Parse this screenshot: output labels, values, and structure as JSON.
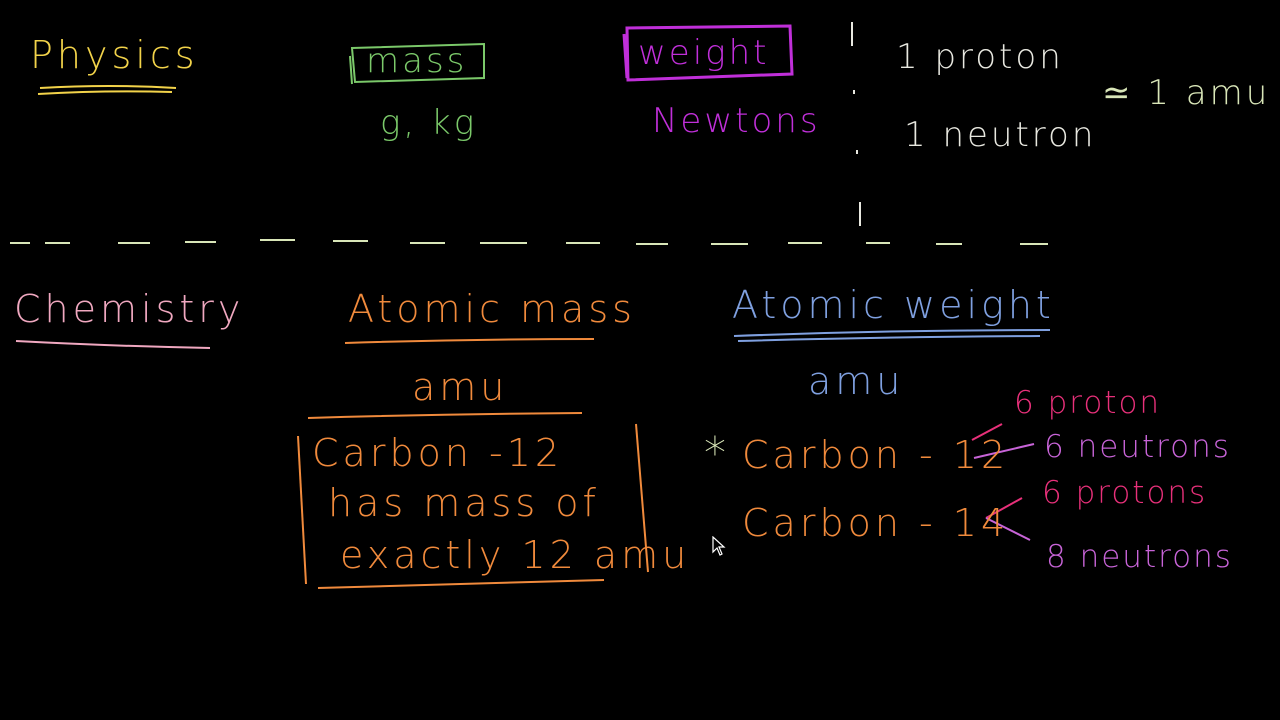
{
  "colors": {
    "background": "#000000",
    "yellow": "#f2d34a",
    "green": "#7bc96a",
    "magenta": "#c02fd9",
    "white": "#e8e8e0",
    "cream": "#d9e6b8",
    "pink": "#f0a8c0",
    "orange": "#f08a3c",
    "blue": "#7fa0e0",
    "purple": "#c864d8",
    "hot_pink": "#e8307a"
  },
  "physics": {
    "heading": "Physics",
    "mass": {
      "label": "mass",
      "units": "g, kg"
    },
    "weight": {
      "label": "weight",
      "units": "Newtons"
    },
    "particles": {
      "proton": "1 proton",
      "neutron": "1 neutron",
      "approx": "≃ 1 amu"
    }
  },
  "chemistry": {
    "heading": "Chemistry",
    "atomic_mass": {
      "label": "Atomic mass",
      "unit": "amu",
      "definition": [
        "Carbon -12",
        "has mass of",
        "exactly 12 amu"
      ]
    },
    "atomic_weight": {
      "label": "Atomic weight",
      "unit": "amu",
      "star": "*",
      "isotopes": [
        {
          "name": "Carbon - 12",
          "protons": "6 proton",
          "neutrons": "6 neutrons"
        },
        {
          "name": "Carbon - 14",
          "protons": "6 protons",
          "neutrons": "8 neutrons"
        }
      ]
    }
  }
}
